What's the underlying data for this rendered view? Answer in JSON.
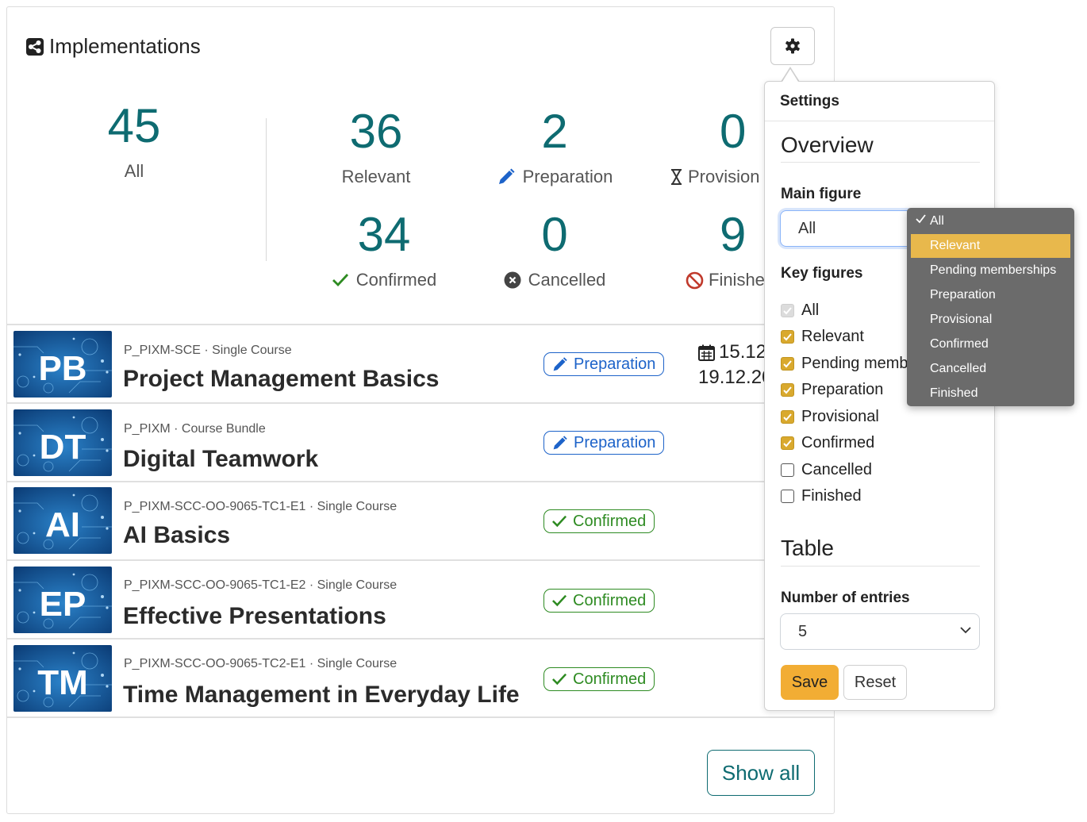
{
  "header": {
    "title": "Implementations",
    "icon": "share-icon",
    "settings_icon": "gear-icon"
  },
  "stats": {
    "main": {
      "value": "45",
      "label": "All"
    },
    "items": [
      {
        "value": "36",
        "label": "Relevant",
        "icon": ""
      },
      {
        "value": "2",
        "label": "Preparation",
        "icon": "pencil-icon"
      },
      {
        "value": "0",
        "label": "Provision",
        "icon": "hourglass-icon"
      },
      {
        "value": "34",
        "label": "Confirmed",
        "icon": "check-icon"
      },
      {
        "value": "0",
        "label": "Cancelled",
        "icon": "x-circle-icon"
      },
      {
        "value": "9",
        "label": "Finishe",
        "icon": "ban-icon"
      }
    ]
  },
  "rows": [
    {
      "abbr": "PB",
      "meta": "P_PIXM-SCE · Single Course",
      "title": "Project Management Basics",
      "status": "Preparation",
      "date_start": "15.12",
      "date_end": "19.12.20"
    },
    {
      "abbr": "DT",
      "meta": "P_PIXM · Course Bundle",
      "title": "Digital Teamwork",
      "status": "Preparation"
    },
    {
      "abbr": "AI",
      "meta": "P_PIXM-SCC-OO-9065-TC1-E1 · Single Course",
      "title": "AI Basics",
      "status": "Confirmed"
    },
    {
      "abbr": "EP",
      "meta": "P_PIXM-SCC-OO-9065-TC1-E2 · Single Course",
      "title": "Effective Presentations",
      "status": "Confirmed"
    },
    {
      "abbr": "TM",
      "meta": "P_PIXM-SCC-OO-9065-TC2-E1 · Single Course",
      "title": "Time Management in Everyday Life",
      "status": "Confirmed"
    }
  ],
  "show_all": "Show all",
  "settings": {
    "title": "Settings",
    "overview_title": "Overview",
    "main_figure_label": "Main figure",
    "main_figure_value": "All",
    "key_figures_label": "Key figures",
    "key_figures": [
      {
        "label": "All",
        "state": "disabled"
      },
      {
        "label": "Relevant",
        "state": "checked"
      },
      {
        "label": "Pending membe",
        "state": "checked"
      },
      {
        "label": "Preparation",
        "state": "checked"
      },
      {
        "label": "Provisional",
        "state": "checked"
      },
      {
        "label": "Confirmed",
        "state": "checked"
      },
      {
        "label": "Cancelled",
        "state": "unchecked"
      },
      {
        "label": "Finished",
        "state": "unchecked"
      }
    ],
    "table_title": "Table",
    "entries_label": "Number of entries",
    "entries_value": "5",
    "save_label": "Save",
    "reset_label": "Reset"
  },
  "dropdown": {
    "selected": "All",
    "highlighted": "Relevant",
    "options": [
      "All",
      "Relevant",
      "Pending memberships",
      "Preparation",
      "Provisional",
      "Confirmed",
      "Cancelled",
      "Finished"
    ]
  },
  "colors": {
    "accent": "#0e6b71",
    "preparation": "#1d63c9",
    "confirmed": "#2e8b22",
    "save": "#f2ad34",
    "checkbox": "#d9a92e",
    "highlight": "#e8b84c"
  }
}
